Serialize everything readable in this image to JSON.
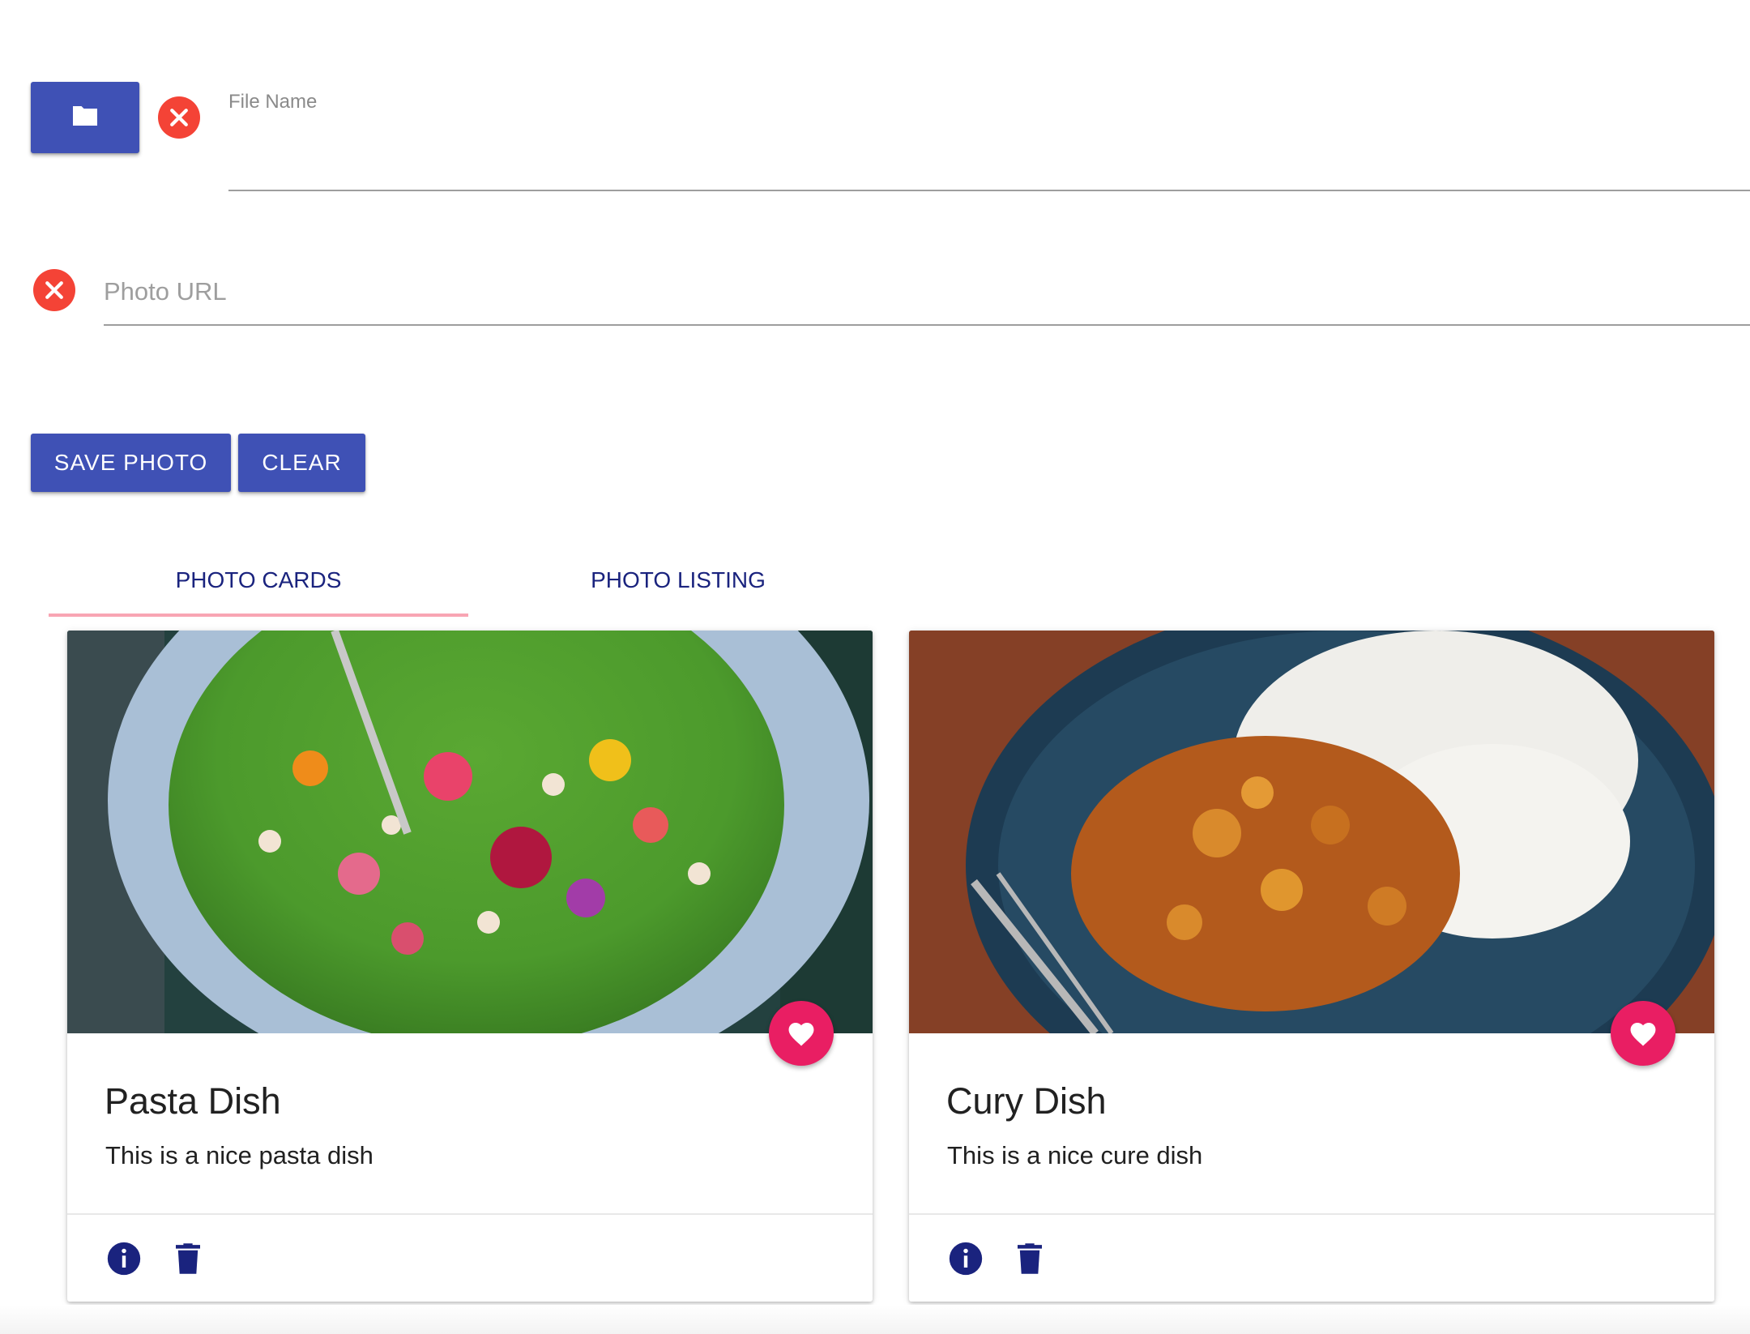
{
  "upload": {
    "folder_icon": "folder-icon",
    "clear_icon": "cancel-icon",
    "file_name_label": "File Name",
    "file_name_value": ""
  },
  "photo_url": {
    "clear_icon": "cancel-icon",
    "placeholder": "Photo URL",
    "value": ""
  },
  "actions": {
    "save_label": "SAVE PHOTO",
    "clear_label": "CLEAR"
  },
  "tabs": [
    {
      "label": "PHOTO CARDS",
      "active": true
    },
    {
      "label": "PHOTO LISTING",
      "active": false
    }
  ],
  "cards": [
    {
      "title": "Pasta Dish",
      "description": "This is a nice pasta dish",
      "favorite_icon": "heart-icon",
      "info_icon": "info-icon",
      "delete_icon": "trash-icon"
    },
    {
      "title": "Cury Dish",
      "description": "This is a nice cure dish",
      "favorite_icon": "heart-icon",
      "info_icon": "info-icon",
      "delete_icon": "trash-icon"
    }
  ],
  "colors": {
    "primary": "#3f51b5",
    "tab_text": "#1a237e",
    "tab_indicator": "#f8a5b3",
    "favorite": "#e91e63",
    "clear": "#f44336",
    "card_icons": "#1a237e"
  }
}
